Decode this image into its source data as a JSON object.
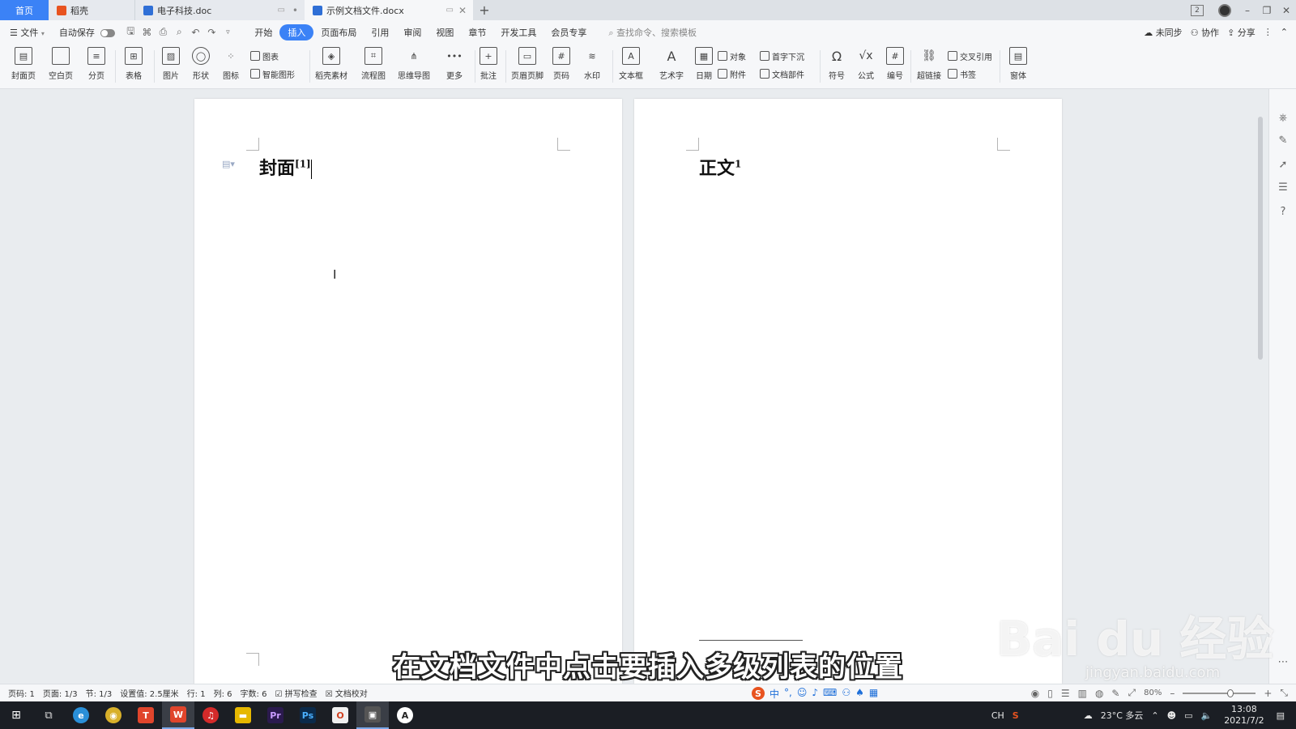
{
  "tabs": {
    "home": "首页",
    "tab1": "稻壳",
    "tab2": "电子科技.doc",
    "tab3": "示例文档文件.docx",
    "add": "+"
  },
  "window": {
    "badge": "2",
    "min": "–",
    "max": "❐",
    "close": "✕"
  },
  "menu": {
    "file": "文件",
    "autosave": "自动保存",
    "items": [
      "开始",
      "插入",
      "页面布局",
      "引用",
      "审阅",
      "视图",
      "章节",
      "开发工具",
      "会员专享"
    ],
    "search": "查找命令、搜索模板",
    "sync": "未同步",
    "collab": "协作",
    "share": "分享"
  },
  "ribbon": {
    "cover": "封面页",
    "blank": "空白页",
    "pagebreak": "分页",
    "table": "表格",
    "picture": "图片",
    "shape": "形状",
    "icon": "图标",
    "chart": "图表",
    "smartart": "智能图形",
    "docer": "稻壳素材",
    "flow": "流程图",
    "mindmap": "思维导图",
    "more": "更多",
    "comment": "批注",
    "header": "页眉页脚",
    "pagenum": "页码",
    "watermark": "水印",
    "textbox": "文本框",
    "wordart": "艺术字",
    "date": "日期",
    "object": "对象",
    "dropcap": "首字下沉",
    "attach": "附件",
    "docpart": "文档部件",
    "symbol": "符号",
    "formula": "公式",
    "numbering": "编号",
    "hyperlink": "超链接",
    "crossref": "交叉引用",
    "bookmark": "书签",
    "window": "窗体"
  },
  "document": {
    "page1_heading": "封面",
    "page1_sup": "[1]",
    "page2_heading": "正文",
    "page2_sup": "1"
  },
  "subtitle": "在文档文件中点击要插入多级列表的位置",
  "watermark": {
    "main": "Bai du 经验",
    "sub": "jingyan.baidu.com"
  },
  "status": {
    "page": "页码: 1",
    "pages": "页面: 1/3",
    "section": "节: 1/3",
    "setting": "设置值: 2.5厘米",
    "row": "行: 1",
    "col": "列: 6",
    "words": "字数: 6",
    "spell": "拼写检查",
    "proof": "文档校对",
    "zoom": "80%"
  },
  "ime": {
    "logo": "S",
    "mode": "中"
  },
  "tray": {
    "lang": "CH",
    "weather": "23°C 多云",
    "time": "13:08",
    "date": "2021/7/2"
  }
}
